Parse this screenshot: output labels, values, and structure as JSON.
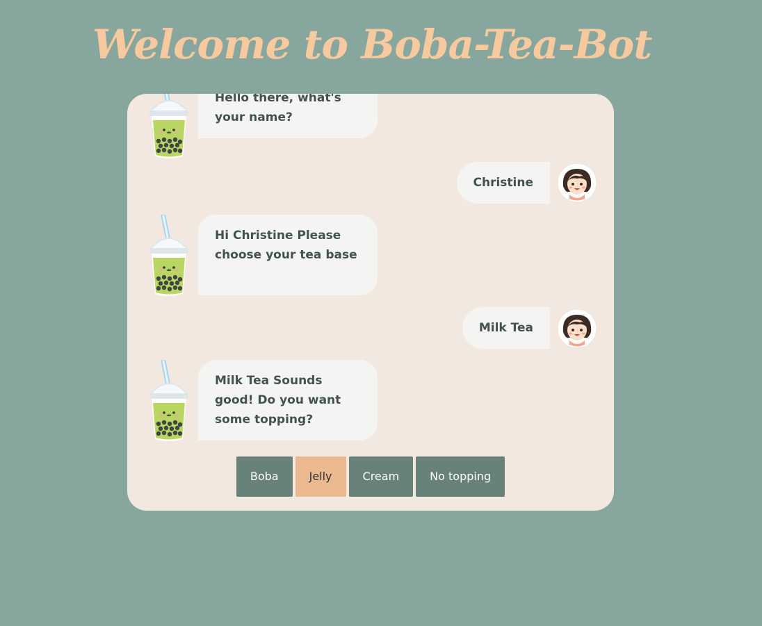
{
  "page": {
    "title": "Welcome to Boba-Tea-Bot"
  },
  "chat": {
    "messages": [
      {
        "sender": "bot",
        "text": "Hello there, what's your name?"
      },
      {
        "sender": "user",
        "text": "Christine"
      },
      {
        "sender": "bot",
        "text": "Hi Christine Please choose your tea base"
      },
      {
        "sender": "user",
        "text": "Milk Tea"
      },
      {
        "sender": "bot",
        "text": "Milk Tea Sounds good! Do you want some topping?"
      }
    ]
  },
  "options": {
    "items": [
      {
        "label": "Boba",
        "selected": false
      },
      {
        "label": "Jelly",
        "selected": true
      },
      {
        "label": "Cream",
        "selected": false
      },
      {
        "label": "No topping",
        "selected": false
      }
    ]
  },
  "icons": {
    "bot_avatar": "bubble-tea-icon",
    "user_avatar": "girl-avatar-icon"
  },
  "colors": {
    "background": "#87a69d",
    "title": "#f7c99f",
    "panel": "#f2e8e0",
    "bubble": "#f4f4f3",
    "button": "#68827a",
    "button_selected": "#ebb990"
  }
}
